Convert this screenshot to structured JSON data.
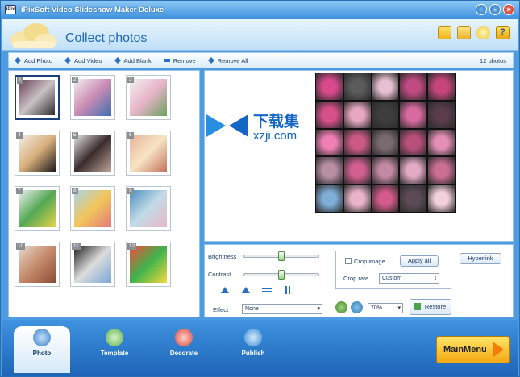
{
  "window": {
    "title": "iPixSoft Video Slideshow Maker Deluxe",
    "app_icon_text": "iPix"
  },
  "header": {
    "title": "Collect photos"
  },
  "toolbar": {
    "add_photo": "Add Photo",
    "add_video": "Add Video",
    "add_blank": "Add Blank",
    "remove": "Remove",
    "remove_all": "Remove All",
    "count": "12 photos"
  },
  "photos": [
    {
      "num": "1",
      "colors": [
        "#6b4256",
        "#c9c2c4",
        "#2e2a2c"
      ]
    },
    {
      "num": "2",
      "colors": [
        "#f3f0ee",
        "#c98bb3",
        "#3d6fb2"
      ]
    },
    {
      "num": "3",
      "colors": [
        "#f4f1ef",
        "#e7b4c8",
        "#6aa25d"
      ]
    },
    {
      "num": "4",
      "colors": [
        "#f2efe9",
        "#d9b07c",
        "#1d1a1a"
      ]
    },
    {
      "num": "5",
      "colors": [
        "#e9e6e4",
        "#3a2c2c",
        "#bfa39a"
      ]
    },
    {
      "num": "6",
      "colors": [
        "#e8b199",
        "#f6e4c4",
        "#c4725c"
      ]
    },
    {
      "num": "7",
      "colors": [
        "#eef2f3",
        "#53a853",
        "#e6d34a"
      ]
    },
    {
      "num": "8",
      "colors": [
        "#a9d4ea",
        "#f1c65a",
        "#e47a7a"
      ]
    },
    {
      "num": "9",
      "colors": [
        "#4d8fbd",
        "#c2dbe8",
        "#e8b8c6"
      ]
    },
    {
      "num": "10",
      "colors": [
        "#e8d9cf",
        "#c58a6b",
        "#8d4d37"
      ]
    },
    {
      "num": "11",
      "colors": [
        "#1d1d1d",
        "#dcdcdc",
        "#7aa6d6"
      ]
    },
    {
      "num": "12",
      "colors": [
        "#f44a3a",
        "#3eb34d",
        "#f6d83c"
      ]
    }
  ],
  "preview": {
    "mosaic_colors": [
      "#d94a8c",
      "#5b5b5b",
      "#e6c0ce",
      "#c14a82",
      "#c7467a",
      "#d8508a",
      "#e7a7c0",
      "#3d3d3d",
      "#d86aa0",
      "#5a3c4a",
      "#f07fb4",
      "#cc5a85",
      "#7a6a70",
      "#b8507a",
      "#e38fb4",
      "#b98fa4",
      "#d35f8f",
      "#c48aa4",
      "#e4a9c4",
      "#cc6f92",
      "#7faed6",
      "#e9b3c9",
      "#d35a8a",
      "#5c4b55",
      "#f2d0dc"
    ],
    "watermark_cn": "下载集",
    "watermark_url": "xzji.com"
  },
  "controls": {
    "brightness_label": "Brightness",
    "contrast_label": "Contrast",
    "brightness_level": 0.5,
    "contrast_level": 0.5,
    "effect_label": "Effect",
    "effect_value": "None",
    "crop_image_label": "Crop image",
    "apply_all_label": "Apply all",
    "crop_rate_label": "Crop rate",
    "crop_rate_value": "Custom",
    "hyperlink_label": "Hyperlink",
    "zoom_value": "70%",
    "restore_label": "Restore"
  },
  "tabs": [
    {
      "label": "Photo",
      "icon": "camera-icon",
      "color": "#3a7cc8"
    },
    {
      "label": "Template",
      "icon": "template-icon",
      "color": "#5ab04c"
    },
    {
      "label": "Decorate",
      "icon": "decorate-icon",
      "color": "#d9443a"
    },
    {
      "label": "Publish",
      "icon": "publish-icon",
      "color": "#3b8bd6"
    }
  ],
  "main_menu": {
    "label": "MainMenu"
  }
}
